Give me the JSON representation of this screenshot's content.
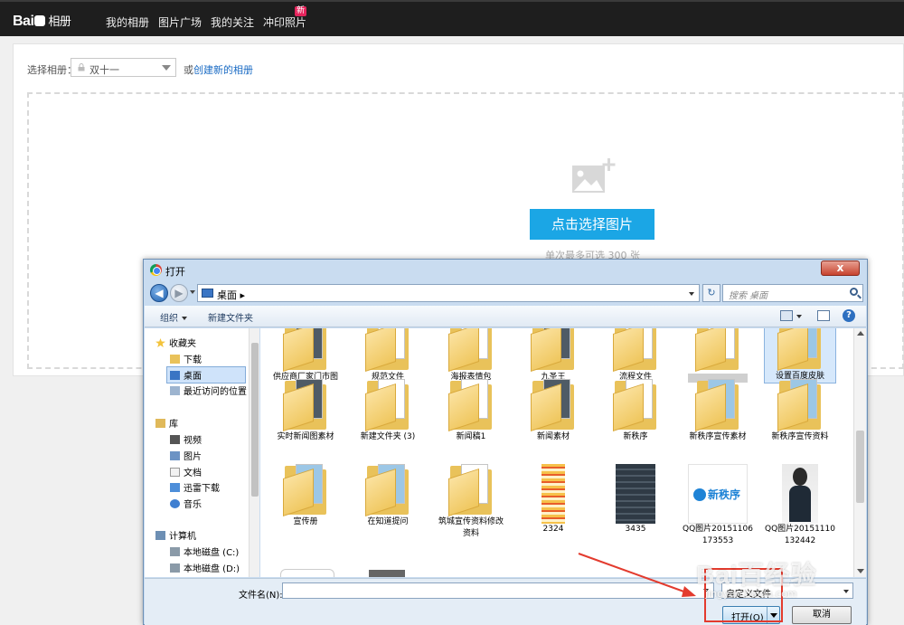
{
  "topbar": {
    "logo_text": "Bai",
    "logo_suffix": "相册",
    "nav": [
      "我的相册",
      "图片广场",
      "我的关注",
      "冲印照片"
    ],
    "new_badge": "新"
  },
  "upload": {
    "select_label": "选择相册：",
    "album_value": "双十一",
    "create_prefix": "或",
    "create_link": "创建新的相册",
    "pick_button": "点击选择图片",
    "hint": "单次最多可选 300 张"
  },
  "dialog": {
    "title": "打开",
    "close": "x",
    "breadcrumb": "桌面",
    "breadcrumb_sep": "▸",
    "search_placeholder": "搜索 桌面",
    "toolbar": {
      "organize": "组织",
      "new_folder": "新建文件夹"
    },
    "help": "?",
    "nav": {
      "favorites": "收藏夹",
      "downloads": "下载",
      "desktop": "桌面",
      "recent": "最近访问的位置",
      "libraries": "库",
      "videos": "视频",
      "pictures": "图片",
      "documents": "文档",
      "xunlei": "迅雷下载",
      "music": "音乐",
      "computer": "计算机",
      "disk_c": "本地磁盘 (C:)",
      "disk_d": "本地磁盘 (D:)"
    },
    "files": [
      "供应商厂家门市图",
      "规范文件",
      "海报表情包",
      "九圣王",
      "流程文件",
      "",
      "设置百度皮肤",
      "实时新闻图素材",
      "新建文件夹 (3)",
      "新闻稿1",
      "新闻素材",
      "新秩序",
      "新秩序宣传素材",
      "新秩序宣传资料",
      "宣传册",
      "在知道提问",
      "筑城宣传资料修改资料",
      "2324",
      "3435",
      "QQ图片20151106173553",
      "QQ图片20151110132442"
    ],
    "thumb_logo_text": "新秩序",
    "filename_label": "文件名(N):",
    "filetype": "自定义文件",
    "open_button": "打开(O)",
    "cancel_button": "取消"
  },
  "watermark": {
    "big": "Bai百经验",
    "small": "jingyan.baidu.com"
  },
  "colors": {
    "accent": "#1ba6e5",
    "highlight": "#e33b2e",
    "badge": "#e5245c"
  }
}
